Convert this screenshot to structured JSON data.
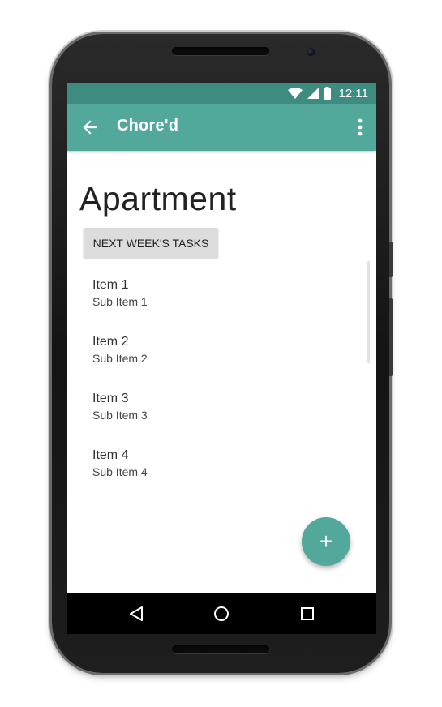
{
  "status_bar": {
    "time": "12:11",
    "icons": [
      "wifi-icon",
      "cell-signal-icon",
      "battery-icon"
    ],
    "color": "#3e8c80"
  },
  "app_bar": {
    "title": "Chore'd",
    "back_icon": "arrow-back-icon",
    "menu_icon": "more-vert-icon",
    "color": "#52a99b"
  },
  "page": {
    "title": "Apartment",
    "next_button_label": "NEXT WEEK'S TASKS"
  },
  "list": {
    "items": [
      {
        "title": "Item 1",
        "subtitle": "Sub Item 1"
      },
      {
        "title": "Item 2",
        "subtitle": "Sub Item 2"
      },
      {
        "title": "Item 3",
        "subtitle": "Sub Item 3"
      },
      {
        "title": "Item 4",
        "subtitle": "Sub Item 4"
      }
    ]
  },
  "fab": {
    "label": "+",
    "color": "#52a99b"
  },
  "nav_bar": {
    "icons": [
      "back-triangle-icon",
      "home-circle-icon",
      "recents-square-icon"
    ]
  }
}
